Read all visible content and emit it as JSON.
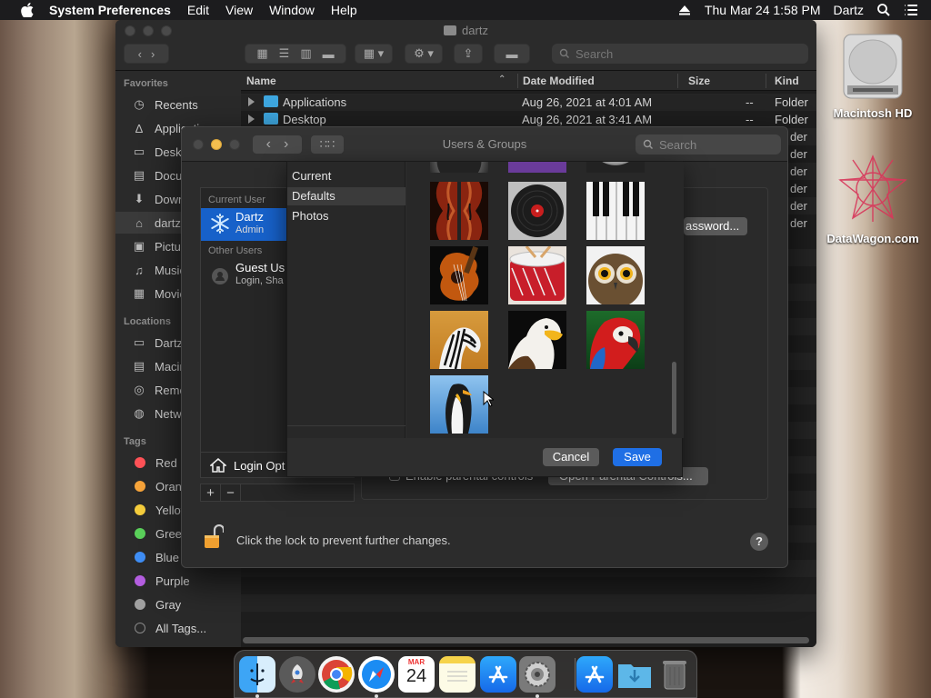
{
  "menubar": {
    "app_name": "System Preferences",
    "menus": [
      "Edit",
      "View",
      "Window",
      "Help"
    ],
    "datetime": "Thu Mar 24  1:58 PM",
    "user": "Dartz"
  },
  "finder": {
    "title": "dartz",
    "search_placeholder": "Search",
    "sidebar": {
      "favorites_header": "Favorites",
      "favorites": [
        "Recents",
        "Applications",
        "Desktop",
        "Documents",
        "Downloads",
        "dartz",
        "Pictures",
        "Music",
        "Movies"
      ],
      "locations_header": "Locations",
      "locations": [
        "Dartz",
        "Macintosh HD",
        "Remote Disc",
        "Network"
      ],
      "tags_header": "Tags",
      "tags": [
        {
          "label": "Red",
          "color": "#ff5257"
        },
        {
          "label": "Orange",
          "color": "#f7a43a"
        },
        {
          "label": "Yellow",
          "color": "#f5cd3c"
        },
        {
          "label": "Green",
          "color": "#5ad05a"
        },
        {
          "label": "Blue",
          "color": "#3f8ef5"
        },
        {
          "label": "Purple",
          "color": "#b45ee0"
        },
        {
          "label": "Gray",
          "color": "#a0a0a0"
        }
      ],
      "all_tags": "All Tags..."
    },
    "columns": {
      "name": "Name",
      "date": "Date Modified",
      "size": "Size",
      "kind": "Kind"
    },
    "rows": [
      {
        "name": "Applications",
        "date": "Aug 26, 2021 at 4:01 AM",
        "size": "--",
        "kind": "Folder"
      },
      {
        "name": "Desktop",
        "date": "Aug 26, 2021 at 3:41 AM",
        "size": "--",
        "kind": "Folder"
      }
    ],
    "hidden_kinds": [
      "der",
      "der",
      "der",
      "der",
      "der",
      "der"
    ]
  },
  "users_groups": {
    "title": "Users & Groups",
    "search_placeholder": "Search",
    "current_user_header": "Current User",
    "current_user": {
      "name": "Dartz",
      "role": "Admin"
    },
    "other_users_header": "Other Users",
    "guest_user": {
      "name": "Guest Us",
      "role": "Login, Sha"
    },
    "login_options": "Login Opt",
    "change_password_label": "assword...",
    "parental_checkbox_label": "Enable parental controls",
    "parental_button_label": "Open Parental Controls...",
    "lock_text": "Click the lock to prevent further changes.",
    "help": "?"
  },
  "picker": {
    "categories": [
      "Current",
      "Defaults",
      "Photos"
    ],
    "selected_category": "Defaults",
    "images": [
      "violin",
      "vinyl-record",
      "piano-keys",
      "guitar",
      "drum",
      "owl",
      "zebra",
      "eagle",
      "parrot",
      "penguin"
    ],
    "cancel_label": "Cancel",
    "save_label": "Save"
  },
  "desktop": {
    "icons": [
      {
        "label": "Macintosh HD"
      },
      {
        "label": "DataWagon.com"
      }
    ]
  },
  "dock": {
    "apps": [
      "Finder",
      "Launchpad",
      "Chrome",
      "Safari",
      "Calendar",
      "Notes",
      "App Store",
      "System Preferences",
      "Applications Folder",
      "Downloads",
      "Trash"
    ],
    "calendar_month": "MAR",
    "calendar_day": "24"
  }
}
